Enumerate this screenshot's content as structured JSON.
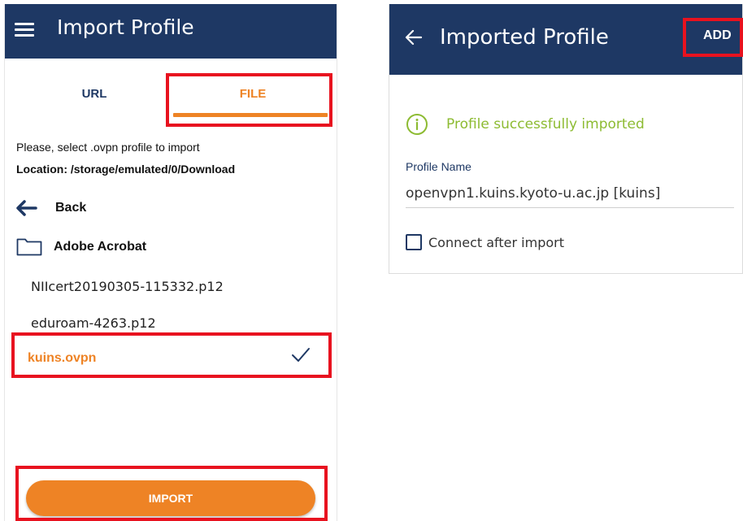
{
  "left": {
    "title": "Import Profile",
    "tabs": [
      {
        "label": "URL",
        "selected": false
      },
      {
        "label": "FILE",
        "selected": true
      }
    ],
    "instruction": "Please, select .ovpn profile to import",
    "location": "Location: /storage/emulated/0/Download",
    "back_label": "Back",
    "folder_label": "Adobe Acrobat",
    "files": [
      {
        "name": "NIIcert20190305-115332.p12",
        "selected": false
      },
      {
        "name": "eduroam-4263.p12",
        "selected": false
      },
      {
        "name": "kuins.ovpn",
        "selected": true
      }
    ],
    "import_label": "IMPORT"
  },
  "right": {
    "title": "Imported Profile",
    "add_label": "ADD",
    "success_message": "Profile successfully imported",
    "profile_name_label": "Profile Name",
    "profile_name_value": "openvpn1.kuins.kyoto-u.ac.jp [kuins]",
    "connect_after_import_label": "Connect after import",
    "connect_after_import_checked": false
  },
  "icons": {
    "menu": "hamburger-icon",
    "back": "arrow-left-icon",
    "folder": "folder-icon",
    "check": "check-icon",
    "info": "info-circle-icon"
  },
  "colors": {
    "appbar": "#1e3864",
    "accent": "#ee8325",
    "success": "#8dbb32",
    "highlight": "#e8121f"
  }
}
